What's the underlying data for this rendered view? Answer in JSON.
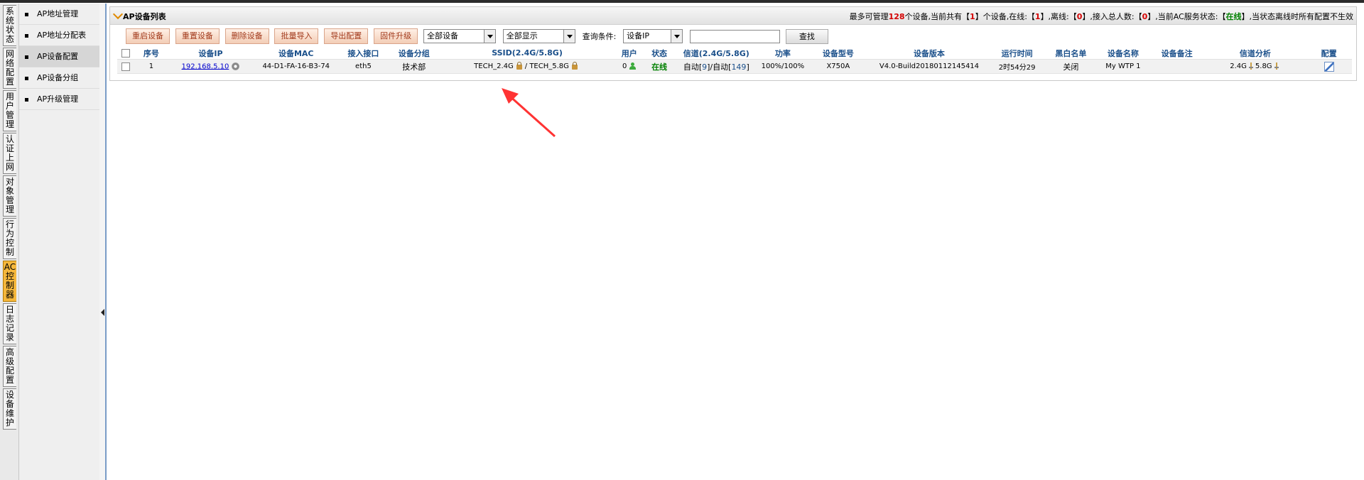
{
  "vtabs": [
    {
      "label": "系统状态",
      "active": false
    },
    {
      "label": "网络配置",
      "active": false
    },
    {
      "label": "用户管理",
      "active": false
    },
    {
      "label": "认证上网",
      "active": false
    },
    {
      "label": "对象管理",
      "active": false
    },
    {
      "label": "行为控制",
      "active": false
    },
    {
      "label": "AC控制器",
      "active": true
    },
    {
      "label": "日志记录",
      "active": false
    },
    {
      "label": "高级配置",
      "active": false
    },
    {
      "label": "设备维护",
      "active": false
    }
  ],
  "submenu": [
    {
      "label": "AP地址管理",
      "active": false
    },
    {
      "label": "AP地址分配表",
      "active": false
    },
    {
      "label": "AP设备配置",
      "active": true
    },
    {
      "label": "AP设备分组",
      "active": false
    },
    {
      "label": "AP升级管理",
      "active": false
    }
  ],
  "panel": {
    "title": "AP设备列表",
    "summary": {
      "p1": "最多可管理",
      "max": "128",
      "p2": "个设备,当前共有【",
      "total": "1",
      "p3": "】个设备,在线:【",
      "online": "1",
      "p4": "】,离线:【",
      "offline": "0",
      "p5": "】,接入总人数:【",
      "users": "0",
      "p6": "】,当前AC服务状态:【",
      "status": "在线",
      "p7": "】,当状态离线时所有配置不生效"
    }
  },
  "toolbar": {
    "buttons": [
      "重启设备",
      "重置设备",
      "删除设备",
      "批量导入",
      "导出配置",
      "固件升级"
    ],
    "filter1": "全部设备",
    "filter2": "全部显示",
    "query_label": "查询条件:",
    "query_field": "设备IP",
    "query_value": "",
    "find": "查找"
  },
  "table": {
    "headers": [
      "序号",
      "设备IP",
      "设备MAC",
      "接入接口",
      "设备分组",
      "SSID(2.4G/5.8G)",
      "用户",
      "状态",
      "信道(2.4G/5.8G)",
      "功率",
      "设备型号",
      "设备版本",
      "运行时间",
      "黑白名单",
      "设备名称",
      "设备备注",
      "信道分析",
      "配置"
    ],
    "rows": [
      {
        "index": "1",
        "ip": "192.168.5.10",
        "mac": "44-D1-FA-16-B3-74",
        "iface": "eth5",
        "group": "技术部",
        "ssid24": "TECH_2.4G",
        "ssid_sep": "/",
        "ssid58": "TECH_5.8G",
        "users": "0",
        "status": "在线",
        "ch_auto1": "自动",
        "ch1": "9",
        "ch_sep": "/",
        "ch_auto2": "自动",
        "ch2": "149",
        "power": "100%/100%",
        "model": "X750A",
        "version": "V4.0-Build20180112145414",
        "uptime": "2时54分29",
        "bwlist": "关闭",
        "name": "My WTP 1",
        "remark": "",
        "ana1": "2.4G",
        "ana2": "5.8G"
      }
    ]
  },
  "colors": {
    "online": "#008000",
    "count": "#d40000",
    "header": "#1a4f8a",
    "annotation_arrow": "#ff3333"
  }
}
